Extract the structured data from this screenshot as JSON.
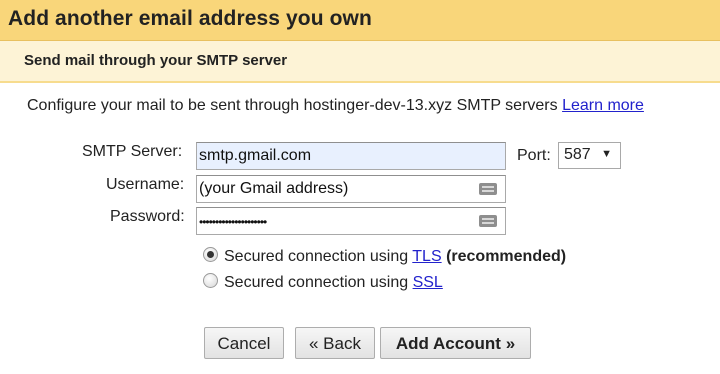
{
  "header": {
    "title": "Add another email address you own"
  },
  "subheader": {
    "title": "Send mail through your SMTP server"
  },
  "description": {
    "text": "Configure your mail to be sent through hostinger-dev-13.xyz SMTP servers",
    "link": "Learn more"
  },
  "form": {
    "smtp_server": {
      "label": "SMTP Server:",
      "value": "smtp.gmail.com"
    },
    "port": {
      "label": "Port:",
      "value": "587",
      "caret": "▼"
    },
    "username": {
      "label": "Username:",
      "value": "(your Gmail address)"
    },
    "password": {
      "label": "Password:",
      "value": "•••••••••••••••••••••"
    }
  },
  "security": {
    "tls": {
      "text": "Secured connection using",
      "link": "TLS",
      "suffix": "(recommended)",
      "checked": true
    },
    "ssl": {
      "text": "Secured connection using",
      "link": "SSL",
      "checked": false
    }
  },
  "buttons": {
    "cancel": "Cancel",
    "back": "« Back",
    "add_account": "Add Account »"
  },
  "colors": {
    "header_bg": "#f9d67a",
    "subheader_bg": "#fdf3d6",
    "link": "#2222cc",
    "autofill_bg": "#e8f0fe"
  },
  "icons": {
    "field_keyboard": "keyboard-icon"
  }
}
